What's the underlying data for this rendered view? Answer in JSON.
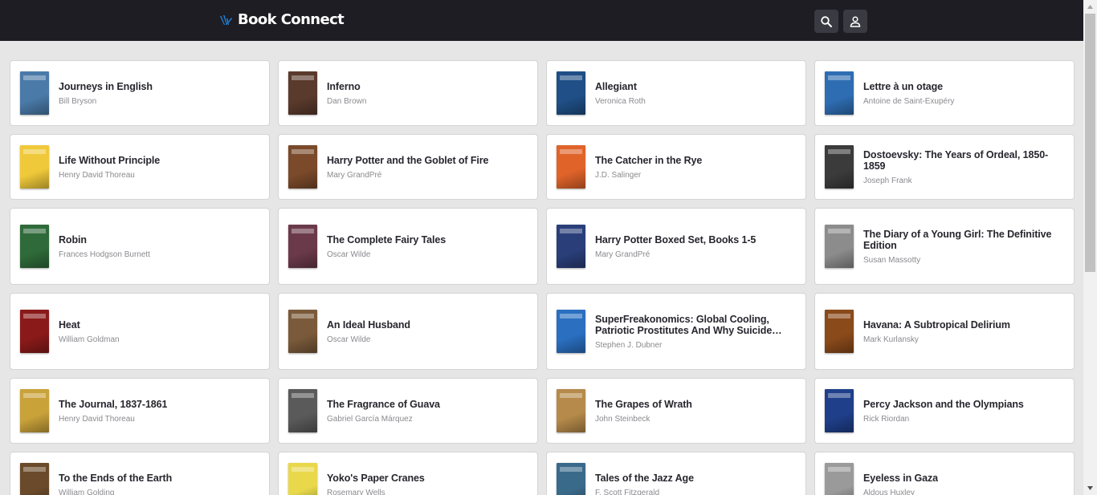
{
  "header": {
    "brand": "Book Connect",
    "search_icon": "search-icon",
    "account_icon": "account-icon",
    "background": "#1e1d24",
    "accent": "#1e88e5"
  },
  "books": [
    {
      "title": "Journeys in English",
      "author": "Bill Bryson",
      "cover_color": "#4a7aa8"
    },
    {
      "title": "Inferno",
      "author": "Dan Brown",
      "cover_color": "#5a3a2c"
    },
    {
      "title": "Allegiant",
      "author": "Veronica Roth",
      "cover_color": "#1f4f86"
    },
    {
      "title": "Lettre à un otage",
      "author": "Antoine de Saint-Exupéry",
      "cover_color": "#2f6db3"
    },
    {
      "title": "Life Without Principle",
      "author": "Henry David Thoreau",
      "cover_color": "#f0c93a"
    },
    {
      "title": "Harry Potter and the Goblet of Fire",
      "author": "Mary GrandPré",
      "cover_color": "#7a4a2a"
    },
    {
      "title": "The Catcher in the Rye",
      "author": "J.D. Salinger",
      "cover_color": "#e0632a"
    },
    {
      "title": "Dostoevsky: The Years of Ordeal, 1850-1859",
      "author": "Joseph Frank",
      "cover_color": "#3b3b3b"
    },
    {
      "title": "Robin",
      "author": "Frances Hodgson Burnett",
      "cover_color": "#2f6b3a"
    },
    {
      "title": "The Complete Fairy Tales",
      "author": "Oscar Wilde",
      "cover_color": "#6b3a4a"
    },
    {
      "title": "Harry Potter Boxed Set, Books 1-5",
      "author": "Mary GrandPré",
      "cover_color": "#2a3f7a"
    },
    {
      "title": "The Diary of a Young Girl: The Definitive Edition",
      "author": "Susan Massotty",
      "cover_color": "#8c8c8c"
    },
    {
      "title": "Heat",
      "author": "William Goldman",
      "cover_color": "#8a1a1a"
    },
    {
      "title": "An Ideal Husband",
      "author": "Oscar Wilde",
      "cover_color": "#7a5a3a"
    },
    {
      "title": "SuperFreakonomics: Global Cooling, Patriotic Prostitutes And Why Suicide Bombers Should Buy Life Insurance",
      "author": "Stephen J. Dubner",
      "cover_color": "#2a6fc0"
    },
    {
      "title": "Havana: A Subtropical Delirium",
      "author": "Mark Kurlansky",
      "cover_color": "#8a4a1a"
    },
    {
      "title": "The Journal, 1837-1861",
      "author": "Henry David Thoreau",
      "cover_color": "#c9a23a"
    },
    {
      "title": "The Fragrance of Guava",
      "author": "Gabriel García Márquez",
      "cover_color": "#5a5a5a"
    },
    {
      "title": "The Grapes of Wrath",
      "author": "John Steinbeck",
      "cover_color": "#b58a4a"
    },
    {
      "title": "Percy Jackson and the Olympians",
      "author": "Rick Riordan",
      "cover_color": "#1f3f8a"
    },
    {
      "title": "To the Ends of the Earth",
      "author": "William Golding",
      "cover_color": "#6a4a2a"
    },
    {
      "title": "Yoko's Paper Cranes",
      "author": "Rosemary Wells",
      "cover_color": "#e8d84a"
    },
    {
      "title": "Tales of the Jazz Age",
      "author": "F. Scott Fitzgerald",
      "cover_color": "#3a6a8a"
    },
    {
      "title": "Eyeless in Gaza",
      "author": "Aldous Huxley",
      "cover_color": "#9a9a9a"
    }
  ],
  "row_heights": [
    82,
    82,
    96,
    96,
    82,
    82
  ]
}
